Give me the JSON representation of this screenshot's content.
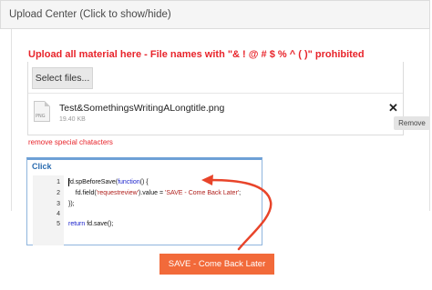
{
  "panel": {
    "title": "Upload Center (Click to show/hide)"
  },
  "upload": {
    "warning": "Upload all material here - File names with \"& ! @ # $ % ^ ( )\" prohibited",
    "select_label": "Select files...",
    "file": {
      "name": "Test&SomethingsWritingALongtitle.png",
      "size": "19.40 KB",
      "icon_ext": "PNG",
      "icon": "file-image-icon"
    },
    "close_glyph": "✕",
    "remove_label": "Remove",
    "remove_special": "remove special chatacters"
  },
  "code_editor": {
    "label": "Click",
    "line_numbers": [
      "1",
      "2",
      "3",
      "4",
      "5"
    ],
    "lines": {
      "l1_a": "fd.spBeforeSave(",
      "l1_kw": "function",
      "l1_b": "() {",
      "l2_a": "    fd.field(",
      "l2_str": "'requestreview'",
      "l2_b": ").value = ",
      "l2_str2": "'SAVE - Come Back Later'",
      "l2_c": ";",
      "l3": "});",
      "l5_kw": "return",
      "l5_b": " fd.save();"
    }
  },
  "save_button": {
    "label": "SAVE - Come Back Later"
  },
  "annotation": {
    "arrow_color": "#e8442a"
  },
  "colors": {
    "accent_red": "#e8242b",
    "button_orange": "#f26a3a",
    "link_blue": "#2b6cb0"
  }
}
